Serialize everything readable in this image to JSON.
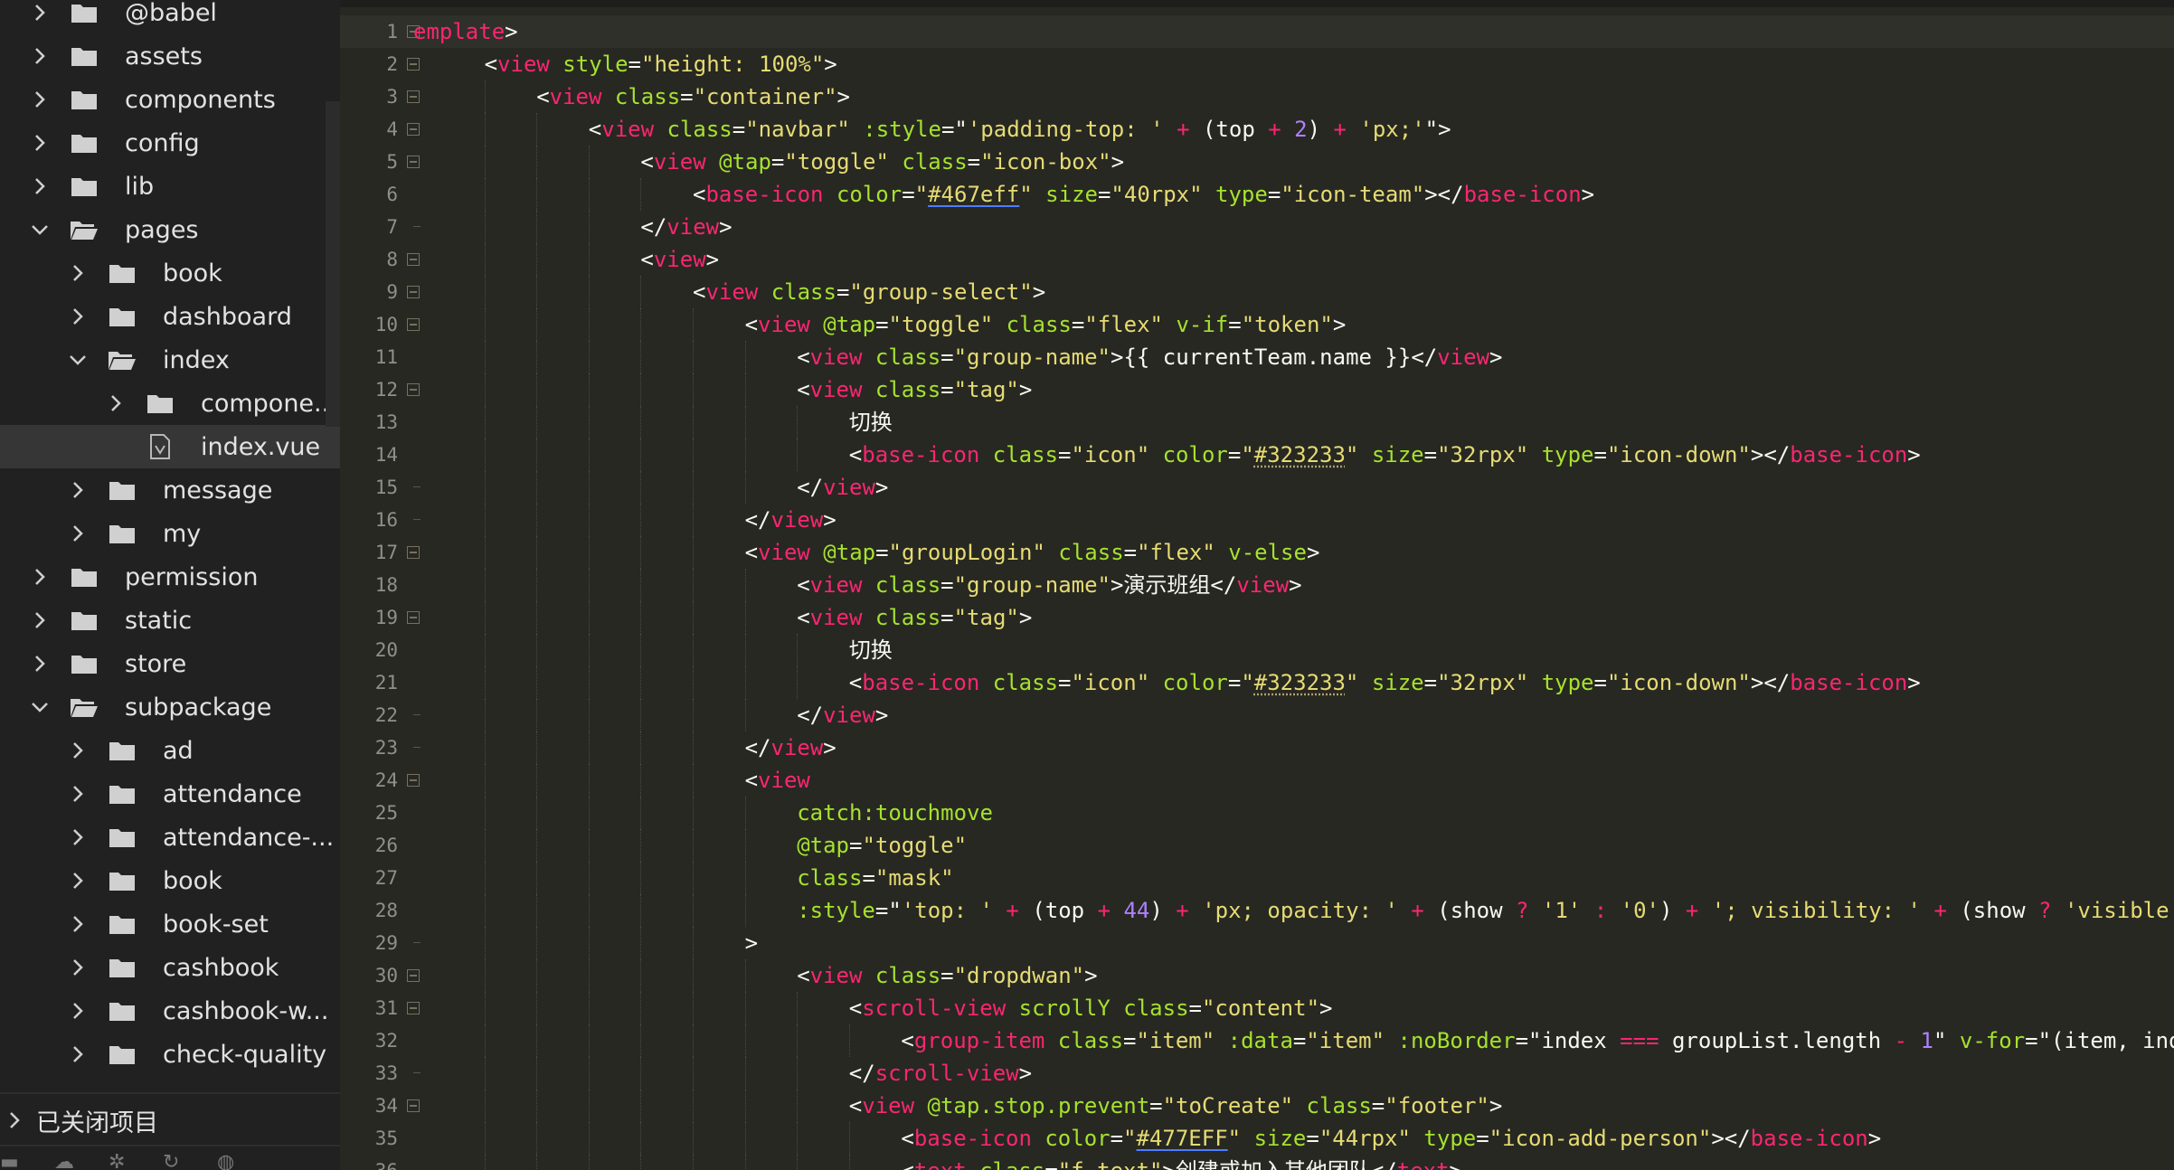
{
  "sidebar": {
    "items": [
      {
        "label": "@babel",
        "depth": 0,
        "type": "folder",
        "expanded": false
      },
      {
        "label": "assets",
        "depth": 0,
        "type": "folder",
        "expanded": false
      },
      {
        "label": "components",
        "depth": 0,
        "type": "folder",
        "expanded": false
      },
      {
        "label": "config",
        "depth": 0,
        "type": "folder",
        "expanded": false
      },
      {
        "label": "lib",
        "depth": 0,
        "type": "folder",
        "expanded": false
      },
      {
        "label": "pages",
        "depth": 0,
        "type": "folder",
        "expanded": true
      },
      {
        "label": "book",
        "depth": 1,
        "type": "folder",
        "expanded": false
      },
      {
        "label": "dashboard",
        "depth": 1,
        "type": "folder",
        "expanded": false
      },
      {
        "label": "index",
        "depth": 1,
        "type": "folder",
        "expanded": true
      },
      {
        "label": "compone...",
        "depth": 2,
        "type": "folder",
        "expanded": false
      },
      {
        "label": "index.vue",
        "depth": 2,
        "type": "file",
        "selected": true
      },
      {
        "label": "message",
        "depth": 1,
        "type": "folder",
        "expanded": false
      },
      {
        "label": "my",
        "depth": 1,
        "type": "folder",
        "expanded": false
      },
      {
        "label": "permission",
        "depth": 0,
        "type": "folder",
        "expanded": false
      },
      {
        "label": "static",
        "depth": 0,
        "type": "folder",
        "expanded": false
      },
      {
        "label": "store",
        "depth": 0,
        "type": "folder",
        "expanded": false
      },
      {
        "label": "subpackage",
        "depth": 0,
        "type": "folder",
        "expanded": true
      },
      {
        "label": "ad",
        "depth": 1,
        "type": "folder",
        "expanded": false
      },
      {
        "label": "attendance",
        "depth": 1,
        "type": "folder",
        "expanded": false
      },
      {
        "label": "attendance-...",
        "depth": 1,
        "type": "folder",
        "expanded": false
      },
      {
        "label": "book",
        "depth": 1,
        "type": "folder",
        "expanded": false
      },
      {
        "label": "book-set",
        "depth": 1,
        "type": "folder",
        "expanded": false
      },
      {
        "label": "cashbook",
        "depth": 1,
        "type": "folder",
        "expanded": false
      },
      {
        "label": "cashbook-w...",
        "depth": 1,
        "type": "folder",
        "expanded": false
      },
      {
        "label": "check-quality",
        "depth": 1,
        "type": "folder",
        "expanded": false
      }
    ],
    "closed_projects_label": "已关闭项目"
  },
  "editor": {
    "current_line": 1,
    "lines": [
      {
        "n": "1",
        "indent": 0,
        "fold": "open",
        "html": "<span class='t'>emplate</span><span class='p'>&gt;</span>"
      },
      {
        "n": "2",
        "indent": 1,
        "fold": "open",
        "html": "<span class='p'>&lt;</span><span class='t'>view</span> <span class='a'>style</span><span class='p'>=</span><span class='s'>\"height: 100%\"</span><span class='p'>&gt;</span>"
      },
      {
        "n": "3",
        "indent": 2,
        "fold": "open",
        "html": "<span class='p'>&lt;</span><span class='t'>view</span> <span class='a'>class</span><span class='p'>=</span><span class='s'>\"container\"</span><span class='p'>&gt;</span>"
      },
      {
        "n": "4",
        "indent": 3,
        "fold": "open",
        "html": "<span class='p'>&lt;</span><span class='t'>view</span> <span class='a'>class</span><span class='p'>=</span><span class='s'>\"navbar\"</span> <span class='a'>:style</span><span class='p'>=\"</span><span class='s'>'padding-top: '</span> <span class='o'>+</span> <span class='p'>(top</span> <span class='o'>+</span> <span class='n'>2</span><span class='p'>)</span> <span class='o'>+</span> <span class='s'>'px;'</span><span class='p'>\"&gt;</span>"
      },
      {
        "n": "5",
        "indent": 4,
        "fold": "open",
        "html": "<span class='p'>&lt;</span><span class='t'>view</span> <span class='a'>@tap</span><span class='p'>=</span><span class='s'>\"toggle\"</span> <span class='a'>class</span><span class='p'>=</span><span class='s'>\"icon-box\"</span><span class='p'>&gt;</span>"
      },
      {
        "n": "6",
        "indent": 5,
        "fold": "none",
        "html": "<span class='p'>&lt;</span><span class='t'>base-icon</span> <span class='a'>color</span><span class='p'>=</span><span class='s'>\"<span class='u'>#467eff</span>\"</span> <span class='a'>size</span><span class='p'>=</span><span class='s'>\"40rpx\"</span> <span class='a'>type</span><span class='p'>=</span><span class='s'>\"icon-team\"</span><span class='p'>&gt;&lt;/</span><span class='t'>base-icon</span><span class='p'>&gt;</span>"
      },
      {
        "n": "7",
        "indent": 4,
        "fold": "end",
        "html": "<span class='p'>&lt;/</span><span class='t'>view</span><span class='p'>&gt;</span>"
      },
      {
        "n": "8",
        "indent": 4,
        "fold": "open",
        "html": "<span class='p'>&lt;</span><span class='t'>view</span><span class='p'>&gt;</span>"
      },
      {
        "n": "9",
        "indent": 5,
        "fold": "open",
        "html": "<span class='p'>&lt;</span><span class='t'>view</span> <span class='a'>class</span><span class='p'>=</span><span class='s'>\"group-select\"</span><span class='p'>&gt;</span>"
      },
      {
        "n": "10",
        "indent": 6,
        "fold": "open",
        "html": "<span class='p'>&lt;</span><span class='t'>view</span> <span class='a'>@tap</span><span class='p'>=</span><span class='s'>\"toggle\"</span> <span class='a'>class</span><span class='p'>=</span><span class='s'>\"flex\"</span> <span class='a'>v-if</span><span class='p'>=</span><span class='s'>\"token\"</span><span class='p'>&gt;</span>"
      },
      {
        "n": "11",
        "indent": 7,
        "fold": "none",
        "html": "<span class='p'>&lt;</span><span class='t'>view</span> <span class='a'>class</span><span class='p'>=</span><span class='s'>\"group-name\"</span><span class='p'>&gt;{{ currentTeam.name }}&lt;/</span><span class='t'>view</span><span class='p'>&gt;</span>"
      },
      {
        "n": "12",
        "indent": 7,
        "fold": "open",
        "html": "<span class='p'>&lt;</span><span class='t'>view</span> <span class='a'>class</span><span class='p'>=</span><span class='s'>\"tag\"</span><span class='p'>&gt;</span>"
      },
      {
        "n": "13",
        "indent": 8,
        "fold": "none",
        "html": "<span class='p'>切换</span>"
      },
      {
        "n": "14",
        "indent": 8,
        "fold": "none",
        "html": "<span class='p'>&lt;</span><span class='t'>base-icon</span> <span class='a'>class</span><span class='p'>=</span><span class='s'>\"icon\"</span> <span class='a'>color</span><span class='p'>=</span><span class='s'>\"<span class='ud'>#323233</span>\"</span> <span class='a'>size</span><span class='p'>=</span><span class='s'>\"32rpx\"</span> <span class='a'>type</span><span class='p'>=</span><span class='s'>\"icon-down\"</span><span class='p'>&gt;&lt;/</span><span class='t'>base-icon</span><span class='p'>&gt;</span>"
      },
      {
        "n": "15",
        "indent": 7,
        "fold": "end",
        "html": "<span class='p'>&lt;/</span><span class='t'>view</span><span class='p'>&gt;</span>"
      },
      {
        "n": "16",
        "indent": 6,
        "fold": "end",
        "html": "<span class='p'>&lt;/</span><span class='t'>view</span><span class='p'>&gt;</span>"
      },
      {
        "n": "17",
        "indent": 6,
        "fold": "open",
        "html": "<span class='p'>&lt;</span><span class='t'>view</span> <span class='a'>@tap</span><span class='p'>=</span><span class='s'>\"groupLogin\"</span> <span class='a'>class</span><span class='p'>=</span><span class='s'>\"flex\"</span> <span class='a'>v-else</span><span class='p'>&gt;</span>"
      },
      {
        "n": "18",
        "indent": 7,
        "fold": "none",
        "html": "<span class='p'>&lt;</span><span class='t'>view</span> <span class='a'>class</span><span class='p'>=</span><span class='s'>\"group-name\"</span><span class='p'>&gt;演示班组&lt;/</span><span class='t'>view</span><span class='p'>&gt;</span>"
      },
      {
        "n": "19",
        "indent": 7,
        "fold": "open",
        "html": "<span class='p'>&lt;</span><span class='t'>view</span> <span class='a'>class</span><span class='p'>=</span><span class='s'>\"tag\"</span><span class='p'>&gt;</span>"
      },
      {
        "n": "20",
        "indent": 8,
        "fold": "none",
        "html": "<span class='p'>切换</span>"
      },
      {
        "n": "21",
        "indent": 8,
        "fold": "none",
        "html": "<span class='p'>&lt;</span><span class='t'>base-icon</span> <span class='a'>class</span><span class='p'>=</span><span class='s'>\"icon\"</span> <span class='a'>color</span><span class='p'>=</span><span class='s'>\"<span class='ud'>#323233</span>\"</span> <span class='a'>size</span><span class='p'>=</span><span class='s'>\"32rpx\"</span> <span class='a'>type</span><span class='p'>=</span><span class='s'>\"icon-down\"</span><span class='p'>&gt;&lt;/</span><span class='t'>base-icon</span><span class='p'>&gt;</span>"
      },
      {
        "n": "22",
        "indent": 7,
        "fold": "end",
        "html": "<span class='p'>&lt;/</span><span class='t'>view</span><span class='p'>&gt;</span>"
      },
      {
        "n": "23",
        "indent": 6,
        "fold": "end",
        "html": "<span class='p'>&lt;/</span><span class='t'>view</span><span class='p'>&gt;</span>"
      },
      {
        "n": "24",
        "indent": 6,
        "fold": "open",
        "html": "<span class='p'>&lt;</span><span class='t'>view</span>"
      },
      {
        "n": "25",
        "indent": 7,
        "fold": "none",
        "html": "<span class='a'>catch:touchmove</span>"
      },
      {
        "n": "26",
        "indent": 7,
        "fold": "none",
        "html": "<span class='a'>@tap</span><span class='p'>=</span><span class='s'>\"toggle\"</span>"
      },
      {
        "n": "27",
        "indent": 7,
        "fold": "none",
        "html": "<span class='a'>class</span><span class='p'>=</span><span class='s'>\"mask\"</span>"
      },
      {
        "n": "28",
        "indent": 7,
        "fold": "none",
        "html": "<span class='a'>:style</span><span class='p'>=\"</span><span class='s'>'top: '</span> <span class='o'>+</span> <span class='p'>(top</span> <span class='o'>+</span> <span class='n'>44</span><span class='p'>)</span> <span class='o'>+</span> <span class='s'>'px; opacity: '</span> <span class='o'>+</span> <span class='p'>(show</span> <span class='o'>?</span> <span class='s'>'1'</span> <span class='o'>:</span> <span class='s'>'0'</span><span class='p'>)</span> <span class='o'>+</span> <span class='s'>'; visibility: '</span> <span class='o'>+</span> <span class='p'>(show</span> <span class='o'>?</span> <span class='s'>'visible'</span> <span class='o'>:</span>"
      },
      {
        "n": "29",
        "indent": 6,
        "fold": "end",
        "html": "<span class='p'>&gt;</span>"
      },
      {
        "n": "30",
        "indent": 7,
        "fold": "open",
        "html": "<span class='p'>&lt;</span><span class='t'>view</span> <span class='a'>class</span><span class='p'>=</span><span class='s'>\"dropdwan\"</span><span class='p'>&gt;</span>"
      },
      {
        "n": "31",
        "indent": 8,
        "fold": "open",
        "html": "<span class='p'>&lt;</span><span class='t'>scroll-view</span> <span class='a'>scrollY</span> <span class='a'>class</span><span class='p'>=</span><span class='s'>\"content\"</span><span class='p'>&gt;</span>"
      },
      {
        "n": "32",
        "indent": 9,
        "fold": "none",
        "html": "<span class='p'>&lt;</span><span class='t'>group-item</span> <span class='a'>class</span><span class='p'>=</span><span class='s'>\"item\"</span> <span class='a'>:data</span><span class='p'>=</span><span class='s'>\"item\"</span> <span class='a'>:noBorder</span><span class='p'>=\"index</span> <span class='o'>===</span> <span class='p'>groupList.length</span> <span class='o'>-</span> <span class='n'>1</span><span class='p'>\"</span> <span class='a'>v-for</span><span class='p'>=\"(item, index) in groupList\"</span>"
      },
      {
        "n": "33",
        "indent": 8,
        "fold": "end",
        "html": "<span class='p'>&lt;/</span><span class='t'>scroll-view</span><span class='p'>&gt;</span>"
      },
      {
        "n": "34",
        "indent": 8,
        "fold": "open",
        "html": "<span class='p'>&lt;</span><span class='t'>view</span> <span class='a'>@tap.stop.prevent</span><span class='p'>=</span><span class='s'>\"toCreate\"</span> <span class='a'>class</span><span class='p'>=</span><span class='s'>\"footer\"</span><span class='p'>&gt;</span>"
      },
      {
        "n": "35",
        "indent": 9,
        "fold": "none",
        "html": "<span class='p'>&lt;</span><span class='t'>base-icon</span> <span class='a'>color</span><span class='p'>=</span><span class='s'>\"<span class='u'>#477EFF</span>\"</span> <span class='a'>size</span><span class='p'>=</span><span class='s'>\"44rpx\"</span> <span class='a'>type</span><span class='p'>=</span><span class='s'>\"icon-add-person\"</span><span class='p'>&gt;&lt;/</span><span class='t'>base-icon</span><span class='p'>&gt;</span>"
      },
      {
        "n": "36",
        "indent": 9,
        "fold": "none",
        "html": "<span class='p'>&lt;</span><span class='t'>text</span> <span class='a'>class</span><span class='p'>=</span><span class='s'>\"f-text\"</span><span class='p'>&gt;创建或加入其他团队&lt;/</span><span class='t'>text</span><span class='p'>&gt;</span>"
      }
    ]
  },
  "colors": {
    "background": "#272822",
    "sidebar": "#212121",
    "tag": "#f92672",
    "attribute": "#a6e22e",
    "string": "#e6db74",
    "number": "#ae81ff"
  }
}
